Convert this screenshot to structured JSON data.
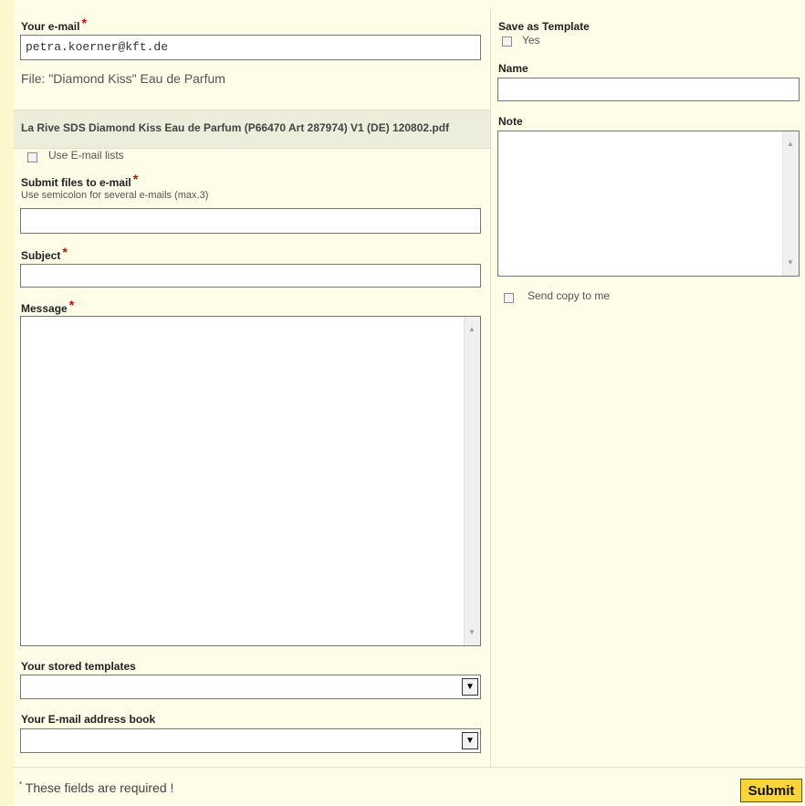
{
  "form": {
    "email_label": "Your e-mail",
    "email_value": "petra.koerner@kft.de",
    "file_label": "File: \"Diamond Kiss\" Eau de Parfum",
    "file_name": "La Rive SDS Diamond Kiss Eau de Parfum (P66470 Art 287974) V1 (DE) 120802.pdf",
    "use_email_lists_label": "Use E-mail lists",
    "submit_to_label": "Submit files to e-mail",
    "submit_to_hint": "Use semicolon for several e-mails (max.3)",
    "submit_to_value": "",
    "subject_label": "Subject",
    "subject_value": "",
    "message_label": "Message",
    "message_value": "",
    "stored_templates_label": "Your stored templates",
    "stored_templates_value": "",
    "address_book_label": "Your E-mail address book",
    "address_book_value": "",
    "required_star": "*"
  },
  "right": {
    "save_template_label": "Save as Template",
    "yes_label": "Yes",
    "name_label": "Name",
    "name_value": "",
    "note_label": "Note",
    "note_value": "",
    "send_copy_label": "Send copy to me"
  },
  "footer": {
    "required_note_star": "*",
    "required_note": " These fields are required !",
    "submit_label": "Submit"
  },
  "icons": {
    "scroll_up": "▲",
    "scroll_down": "▼",
    "dropdown": "▼"
  },
  "colors": {
    "page_bg": "#fdfde8",
    "required": "#e00000",
    "submit_bg": "#f9d535"
  }
}
